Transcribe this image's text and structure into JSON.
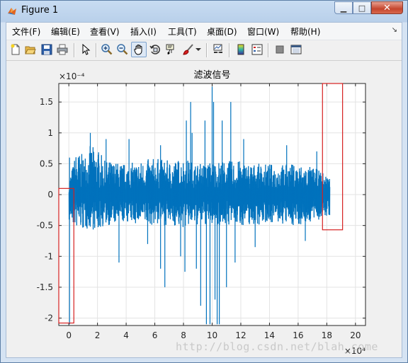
{
  "window": {
    "title": "Figure 1",
    "minimize": "▁",
    "maximize": "□",
    "close": "✕"
  },
  "menu": [
    "文件(F)",
    "编辑(E)",
    "查看(V)",
    "插入(I)",
    "工具(T)",
    "桌面(D)",
    "窗口(W)",
    "帮助(H)"
  ],
  "menu_arrow": "↘",
  "toolbar": [
    "new-figure",
    "open-file",
    "save",
    "print",
    "edit-plot-pointer",
    "zoom-in",
    "zoom-out",
    "pan-hand",
    "rotate-3d",
    "data-cursor",
    "brush",
    "brush-dropdown",
    "link-plot",
    "insert-colorbar",
    "insert-legend",
    "hide-plot-tools",
    "show-plot-tools"
  ],
  "watermark": "http://blog.csdn.net/blah_come",
  "colors": {
    "series": "#0072bd",
    "highlight_box": "#d62020",
    "axes_bg": "#ffffff",
    "grid": "#e3e3e3"
  },
  "chart_data": {
    "type": "line",
    "title": "滤波信号",
    "xlabel": "",
    "ylabel": "",
    "x_exponent_label": "×10⁴",
    "y_exponent_label": "×10⁻⁴",
    "xlim": [
      -0.7,
      20.7
    ],
    "ylim": [
      -2.12,
      1.8
    ],
    "xticks": [
      0,
      2,
      4,
      6,
      8,
      10,
      12,
      14,
      16,
      18,
      20
    ],
    "yticks": [
      -2,
      -1.5,
      -1,
      -0.5,
      0,
      0.5,
      1,
      1.5
    ],
    "ytick_labels": [
      "-2",
      "-1.5",
      "-1",
      "-0.5",
      "0",
      "0.5",
      "1",
      "1.5"
    ],
    "grid": true,
    "series": [
      {
        "x_range": [
          0,
          18.2
        ],
        "envelope": [
          {
            "x": 0.0,
            "max": 0.25,
            "min": -0.45
          },
          {
            "x": 0.5,
            "max": 0.7,
            "min": -0.55
          },
          {
            "x": 1.0,
            "max": 0.65,
            "min": -0.6
          },
          {
            "x": 1.5,
            "max": 0.8,
            "min": -0.55
          },
          {
            "x": 2.0,
            "max": 0.75,
            "min": -0.6
          },
          {
            "x": 2.5,
            "max": 0.55,
            "min": -0.5
          },
          {
            "x": 3.0,
            "max": 0.55,
            "min": -0.5
          },
          {
            "x": 4.0,
            "max": 0.5,
            "min": -0.45
          },
          {
            "x": 5.0,
            "max": 0.55,
            "min": -0.5
          },
          {
            "x": 6.0,
            "max": 0.6,
            "min": -0.5
          },
          {
            "x": 7.0,
            "max": 0.55,
            "min": -0.5
          },
          {
            "x": 8.0,
            "max": 0.6,
            "min": -0.55
          },
          {
            "x": 9.0,
            "max": 0.5,
            "min": -0.5
          },
          {
            "x": 10.0,
            "max": 0.55,
            "min": -0.5
          },
          {
            "x": 11.0,
            "max": 0.55,
            "min": -0.5
          },
          {
            "x": 12.0,
            "max": 0.55,
            "min": -0.5
          },
          {
            "x": 13.0,
            "max": 0.5,
            "min": -0.5
          },
          {
            "x": 14.0,
            "max": 0.5,
            "min": -0.45
          },
          {
            "x": 15.0,
            "max": 0.5,
            "min": -0.5
          },
          {
            "x": 16.0,
            "max": 0.5,
            "min": -0.5
          },
          {
            "x": 17.0,
            "max": 0.45,
            "min": -0.45
          },
          {
            "x": 18.2,
            "max": 0.3,
            "min": -0.35
          }
        ],
        "spikes": [
          {
            "x": 0.05,
            "y": -2.1
          },
          {
            "x": 0.05,
            "y": 0.6
          },
          {
            "x": 1.5,
            "y": 1.0
          },
          {
            "x": 2.6,
            "y": 0.9
          },
          {
            "x": 3.5,
            "y": -1.1
          },
          {
            "x": 4.2,
            "y": 0.9
          },
          {
            "x": 5.5,
            "y": -0.8
          },
          {
            "x": 6.4,
            "y": -1.2
          },
          {
            "x": 6.4,
            "y": 0.8
          },
          {
            "x": 6.7,
            "y": -1.5
          },
          {
            "x": 7.8,
            "y": -1.0
          },
          {
            "x": 8.1,
            "y": -1.25
          },
          {
            "x": 8.2,
            "y": 1.2
          },
          {
            "x": 8.5,
            "y": 1.5
          },
          {
            "x": 8.6,
            "y": 1.0
          },
          {
            "x": 8.9,
            "y": -1.2
          },
          {
            "x": 9.2,
            "y": -1.8
          },
          {
            "x": 9.5,
            "y": 1.2
          },
          {
            "x": 9.6,
            "y": -2.1
          },
          {
            "x": 9.85,
            "y": -2.1
          },
          {
            "x": 10.0,
            "y": 1.75
          },
          {
            "x": 10.1,
            "y": 1.5
          },
          {
            "x": 10.2,
            "y": -1.7
          },
          {
            "x": 10.35,
            "y": -2.1
          },
          {
            "x": 10.5,
            "y": -2.1
          },
          {
            "x": 10.7,
            "y": 1.2
          },
          {
            "x": 11.0,
            "y": -1.5
          },
          {
            "x": 11.3,
            "y": 1.5
          },
          {
            "x": 11.6,
            "y": -1.1
          },
          {
            "x": 12.2,
            "y": 0.9
          },
          {
            "x": 13.0,
            "y": -0.85
          },
          {
            "x": 15.2,
            "y": 0.8
          },
          {
            "x": 16.5,
            "y": -0.75
          },
          {
            "x": 17.3,
            "y": 0.7
          }
        ]
      }
    ],
    "highlight_boxes": [
      {
        "x0": -0.7,
        "x1": 0.35,
        "y0": -2.08,
        "y1": 0.1
      },
      {
        "x0": 17.7,
        "x1": 19.1,
        "y0": -0.57,
        "y1": 1.8
      }
    ]
  }
}
